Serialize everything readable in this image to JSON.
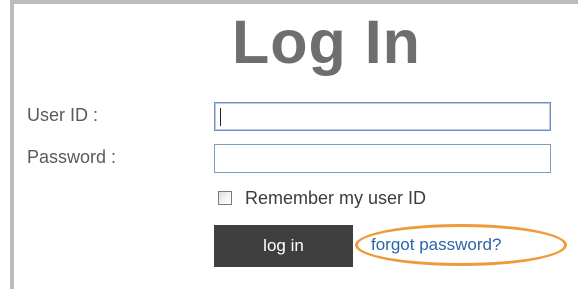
{
  "header": {
    "title": "Log In"
  },
  "form": {
    "user_id": {
      "label": "User ID :",
      "value": ""
    },
    "password": {
      "label": "Password :",
      "value": ""
    },
    "remember": {
      "label": "Remember my user ID",
      "checked": false
    },
    "login_label": "log in",
    "forgot_label": "forgot password?"
  },
  "colors": {
    "title": "#6e6e6e",
    "button_bg": "#3f3f3f",
    "link": "#2c64a8",
    "highlight_ring": "#ee9a3a",
    "field_border": "#7f9db9"
  }
}
